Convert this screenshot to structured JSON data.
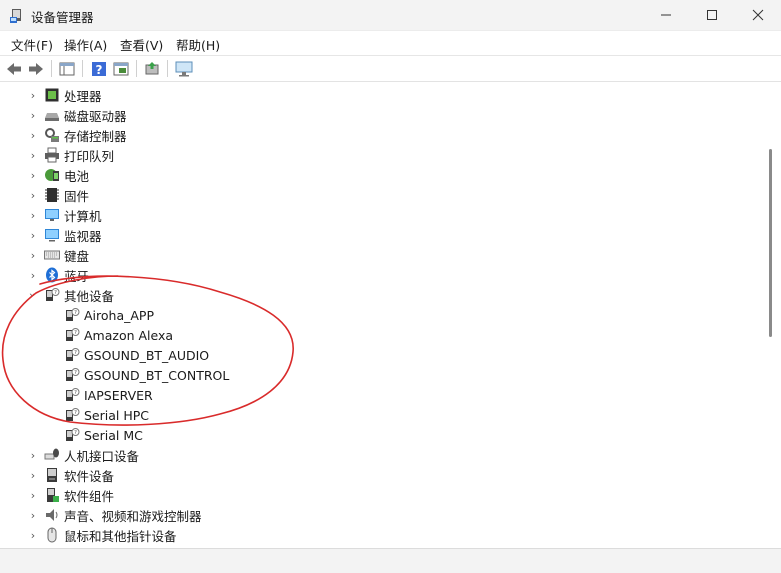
{
  "window": {
    "title": "设备管理器",
    "controls": {
      "minimize_icon": "minimize-icon",
      "maximize_icon": "maximize-icon",
      "close_icon": "close-icon"
    }
  },
  "menu": {
    "items": [
      {
        "label": "文件(F)"
      },
      {
        "label": "操作(A)"
      },
      {
        "label": "查看(V)"
      },
      {
        "label": "帮助(H)"
      }
    ]
  },
  "toolbar": {
    "buttons": [
      {
        "icon": "back-arrow-icon"
      },
      {
        "icon": "forward-arrow-icon"
      },
      {
        "icon": "show-hide-console-tree-icon"
      },
      {
        "icon": "help-icon"
      },
      {
        "icon": "properties-icon"
      },
      {
        "icon": "update-driver-icon"
      },
      {
        "icon": "scan-hardware-icon"
      }
    ]
  },
  "tree": {
    "categories": [
      {
        "label": "处理器",
        "icon": "processor-icon",
        "expanded": false
      },
      {
        "label": "磁盘驱动器",
        "icon": "disk-drive-icon",
        "expanded": false
      },
      {
        "label": "存储控制器",
        "icon": "storage-controller-icon",
        "expanded": false
      },
      {
        "label": "打印队列",
        "icon": "printer-icon",
        "expanded": false
      },
      {
        "label": "电池",
        "icon": "battery-icon",
        "expanded": false
      },
      {
        "label": "固件",
        "icon": "firmware-icon",
        "expanded": false
      },
      {
        "label": "计算机",
        "icon": "computer-icon",
        "expanded": false
      },
      {
        "label": "监视器",
        "icon": "monitor-icon",
        "expanded": false
      },
      {
        "label": "键盘",
        "icon": "keyboard-icon",
        "expanded": false
      },
      {
        "label": "蓝牙",
        "icon": "bluetooth-icon",
        "expanded": false
      },
      {
        "label": "其他设备",
        "icon": "unknown-device-icon",
        "expanded": true
      },
      {
        "label": "人机接口设备",
        "icon": "hid-icon",
        "expanded": false
      },
      {
        "label": "软件设备",
        "icon": "software-device-icon",
        "expanded": false
      },
      {
        "label": "软件组件",
        "icon": "software-component-icon",
        "expanded": false
      },
      {
        "label": "声音、视频和游戏控制器",
        "icon": "speaker-icon",
        "expanded": false
      },
      {
        "label": "鼠标和其他指针设备",
        "icon": "mouse-icon",
        "expanded": false
      }
    ],
    "other_devices": [
      {
        "label": "Airoha_APP",
        "icon": "unknown-device-icon"
      },
      {
        "label": "Amazon Alexa",
        "icon": "unknown-device-icon"
      },
      {
        "label": "GSOUND_BT_AUDIO",
        "icon": "unknown-device-icon"
      },
      {
        "label": "GSOUND_BT_CONTROL",
        "icon": "unknown-device-icon"
      },
      {
        "label": "IAPSERVER",
        "icon": "unknown-device-icon"
      },
      {
        "label": "Serial HPC",
        "icon": "unknown-device-icon"
      },
      {
        "label": "Serial MC",
        "icon": "unknown-device-icon"
      }
    ]
  },
  "annotation": {
    "color": "#d92b2b",
    "shape": "hand-drawn-ellipse"
  },
  "colors": {
    "titlebar": "#f3f3f3",
    "scrollbar_thumb": "#8a8a8a",
    "help_icon": "#3b6bd6"
  }
}
